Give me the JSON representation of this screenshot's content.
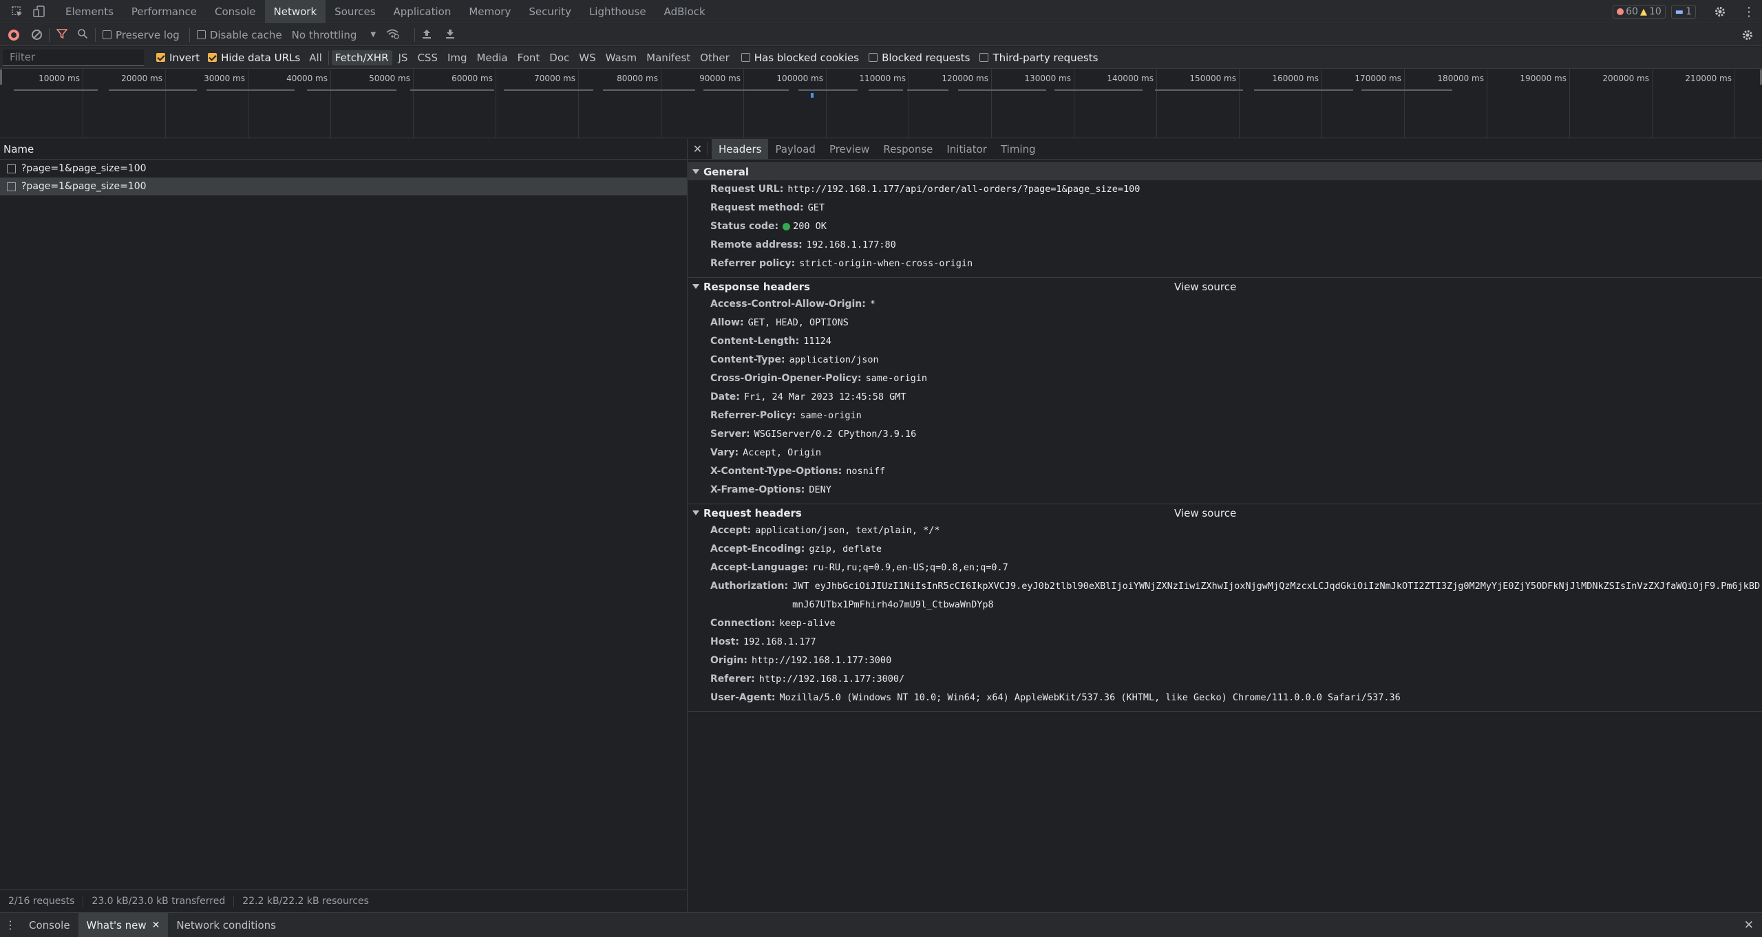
{
  "topbar": {
    "tabs": [
      {
        "label": "Elements"
      },
      {
        "label": "Performance"
      },
      {
        "label": "Console"
      },
      {
        "label": "Network"
      },
      {
        "label": "Sources"
      },
      {
        "label": "Application"
      },
      {
        "label": "Memory"
      },
      {
        "label": "Security"
      },
      {
        "label": "Lighthouse"
      },
      {
        "label": "AdBlock"
      }
    ],
    "active_tab": "Network",
    "errors_count": "60",
    "warnings_count": "10",
    "messages_count": "1",
    "colors": {
      "error": "#f28b82",
      "warning": "#fdd663",
      "info": "#8ab4f8"
    }
  },
  "toolbar": {
    "preserve_log": "Preserve log",
    "disable_cache": "Disable cache",
    "throttling": "No throttling"
  },
  "filterbar": {
    "placeholder": "Filter",
    "invert": "Invert",
    "hide_data_urls": "Hide data URLs",
    "types": [
      "All",
      "Fetch/XHR",
      "JS",
      "CSS",
      "Img",
      "Media",
      "Font",
      "Doc",
      "WS",
      "Wasm",
      "Manifest",
      "Other"
    ],
    "active_type": "Fetch/XHR",
    "has_blocked_cookies": "Has blocked cookies",
    "blocked_requests": "Blocked requests",
    "third_party": "Third-party requests"
  },
  "timeline": {
    "ticks": [
      "10000 ms",
      "20000 ms",
      "30000 ms",
      "40000 ms",
      "50000 ms",
      "60000 ms",
      "70000 ms",
      "80000 ms",
      "90000 ms",
      "100000 ms",
      "110000 ms",
      "120000 ms",
      "130000 ms",
      "140000 ms",
      "150000 ms",
      "160000 ms",
      "170000 ms",
      "180000 ms",
      "190000 ms",
      "200000 ms",
      "210000 ms"
    ]
  },
  "requests": {
    "header": "Name",
    "rows": [
      {
        "name": "?page=1&page_size=100"
      },
      {
        "name": "?page=1&page_size=100"
      }
    ]
  },
  "status": {
    "requests": "2/16 requests",
    "transferred": "23.0 kB/23.0 kB transferred",
    "resources": "22.2 kB/22.2 kB resources"
  },
  "details": {
    "tabs": [
      "Headers",
      "Payload",
      "Preview",
      "Response",
      "Initiator",
      "Timing"
    ],
    "active_tab": "Headers",
    "general": {
      "title": "General",
      "rows": [
        {
          "k": "Request URL:",
          "v": "http://192.168.1.177/api/order/all-orders/?page=1&page_size=100"
        },
        {
          "k": "Request method:",
          "v": "GET"
        },
        {
          "k": "Status code:",
          "v": "200 OK"
        },
        {
          "k": "Remote address:",
          "v": "192.168.1.177:80"
        },
        {
          "k": "Referrer policy:",
          "v": "strict-origin-when-cross-origin"
        }
      ]
    },
    "response_headers": {
      "title": "Response headers",
      "view_source": "View source",
      "rows": [
        {
          "k": "Access-Control-Allow-Origin:",
          "v": "*"
        },
        {
          "k": "Allow:",
          "v": "GET, HEAD, OPTIONS"
        },
        {
          "k": "Content-Length:",
          "v": "11124"
        },
        {
          "k": "Content-Type:",
          "v": "application/json"
        },
        {
          "k": "Cross-Origin-Opener-Policy:",
          "v": "same-origin"
        },
        {
          "k": "Date:",
          "v": "Fri, 24 Mar 2023 12:45:58 GMT"
        },
        {
          "k": "Referrer-Policy:",
          "v": "same-origin"
        },
        {
          "k": "Server:",
          "v": "WSGIServer/0.2 CPython/3.9.16"
        },
        {
          "k": "Vary:",
          "v": "Accept, Origin"
        },
        {
          "k": "X-Content-Type-Options:",
          "v": "nosniff"
        },
        {
          "k": "X-Frame-Options:",
          "v": "DENY"
        }
      ]
    },
    "request_headers": {
      "title": "Request headers",
      "view_source": "View source",
      "rows": [
        {
          "k": "Accept:",
          "v": "application/json, text/plain, */*"
        },
        {
          "k": "Accept-Encoding:",
          "v": "gzip, deflate"
        },
        {
          "k": "Accept-Language:",
          "v": "ru-RU,ru;q=0.9,en-US;q=0.8,en;q=0.7"
        },
        {
          "k": "Authorization:",
          "v": "JWT eyJhbGciOiJIUzI1NiIsInR5cCI6IkpXVCJ9.eyJ0b2tlbl90eXBlIjoiYWNjZXNzIiwiZXhwIjoxNjgwMjQzMzcxLCJqdGkiOiIzNmJkOTI2ZTI3Zjg0M2MyYjE0ZjY5ODFkNjJlMDNkZSIsInVzZXJfaWQiOjF9.Pm6jkBDmnJ67UTbx1PmFhirh4o7mU9l_CtbwaWnDYp8"
        },
        {
          "k": "Connection:",
          "v": "keep-alive"
        },
        {
          "k": "Host:",
          "v": "192.168.1.177"
        },
        {
          "k": "Origin:",
          "v": "http://192.168.1.177:3000"
        },
        {
          "k": "Referer:",
          "v": "http://192.168.1.177:3000/"
        },
        {
          "k": "User-Agent:",
          "v": "Mozilla/5.0 (Windows NT 10.0; Win64; x64) AppleWebKit/537.36 (KHTML, like Gecko) Chrome/111.0.0.0 Safari/537.36"
        }
      ]
    },
    "status_color": "#34a853"
  },
  "drawer": {
    "tabs": [
      {
        "label": "Console"
      },
      {
        "label": "What's new"
      },
      {
        "label": "Network conditions"
      }
    ],
    "active_tab": "What's new"
  }
}
